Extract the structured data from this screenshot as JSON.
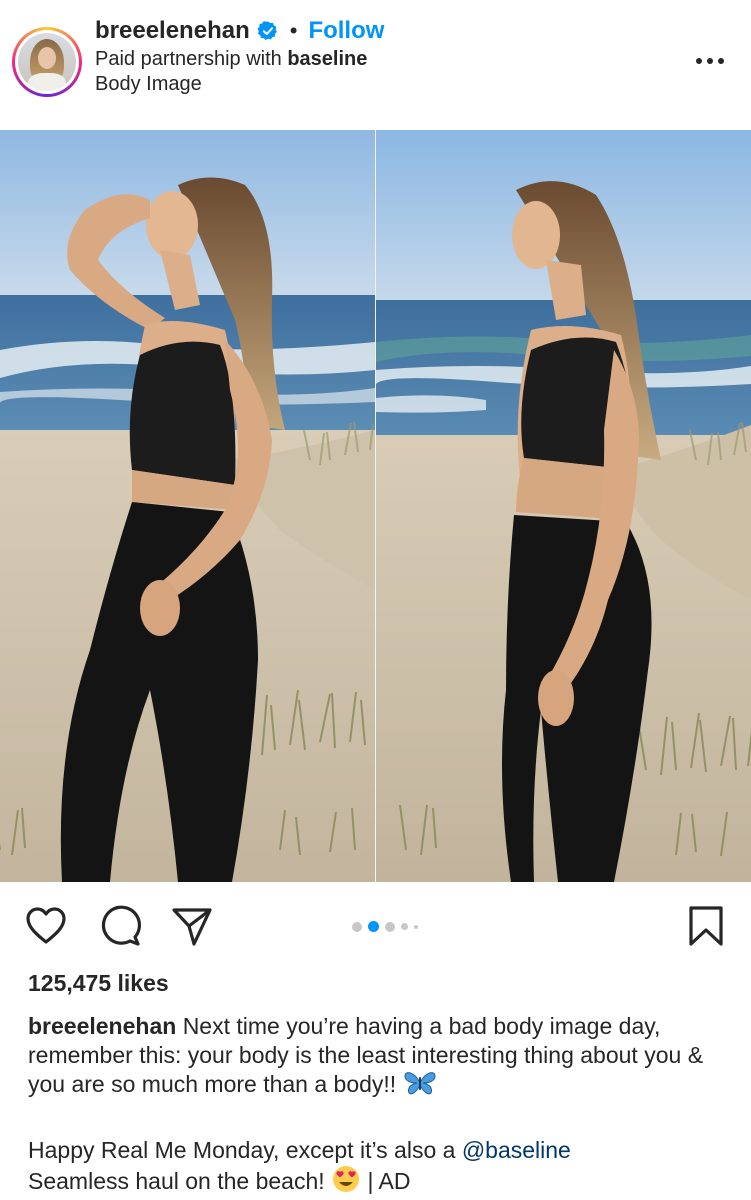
{
  "post": {
    "username": "breeelenehan",
    "verified": true,
    "separator": "•",
    "follow_label": "Follow",
    "partnership_prefix": "Paid partnership with",
    "partner": "baseline",
    "location": "Body Image",
    "more_icon": "more-horizontal-icon"
  },
  "media": {
    "slide_count": 5,
    "active_slide": 2,
    "accent_color": "#0095f6"
  },
  "actions": {
    "like_icon": "heart-icon",
    "comment_icon": "comment-icon",
    "share_icon": "send-icon",
    "save_icon": "bookmark-icon"
  },
  "likes": "125,475 likes",
  "caption": {
    "username": "breeelenehan",
    "text": "Next time you’re having a bad body image day, remember this: your body is the least interesting thing about you & you are so much more than a body!!",
    "emoji1": "butterfly-emoji",
    "line2_text": "Happy Real Me Monday, except it’s also a",
    "mention": "@baseline",
    "line3_text": "Seamless haul on the beach!",
    "emoji2": "heart-eyes-emoji",
    "ad_text": "| AD"
  }
}
